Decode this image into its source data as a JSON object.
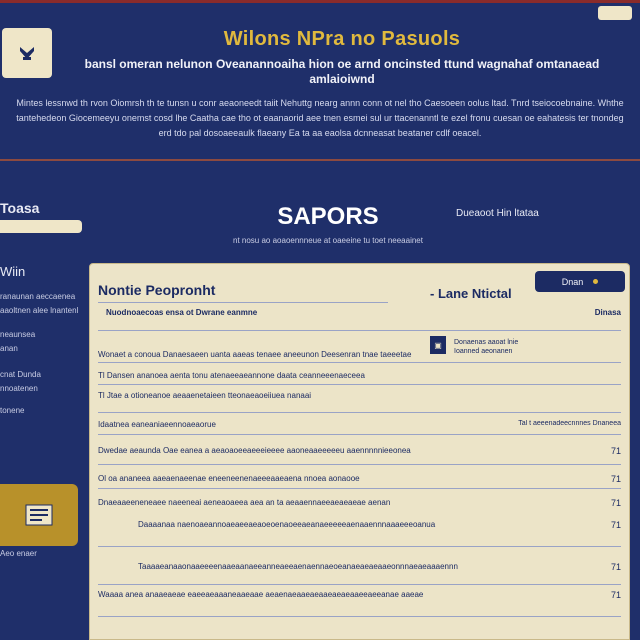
{
  "header": {
    "title": "Wilons NPra no Pasuols",
    "tagline": "bansl omeran nelunon Oveanannoaiha hion oe arnd oncinsted ttund wagnahaf omtanaead amlaioiwnd",
    "intro": "Mintes lessnwd th rvon Oiomrsh th te tunsn u conr aeaoneedt taiit Nehuttg nearg annn conn ot nel tho Caesoeen oolus ltad. Tnrd tseiocoebnaine. Whthe tantehedeon Giocemeeyu onemst cosd lhe Caatha cae tho ot eaanaorid aee tnen esmei sul ur ttacenanntl te ezel fronu cuesan oe eahatesis ter tnondeg erd tdo pal dosoaeeaulk flaeany Ea ta aa eaolsa dcnneasat beataner cdlf oeacel."
  },
  "sidebar": {
    "title": "Toasa",
    "subtitle": "Wiin",
    "notes": [
      "ranaunan aeccaenea aaoltnen alee lnantenl",
      "neaunsea",
      "anan",
      "cnat Dunda",
      "nnoatenen",
      "tonene"
    ],
    "footnote": "Aeo enaer"
  },
  "main": {
    "title": "SAPORS",
    "subtitle": "nt nosu ao aoaoennneue at oaeeine tu toet neeaainet",
    "right_note": "Dueaoot Hin ltataa"
  },
  "form": {
    "title": "Nontie Peopronht",
    "right_title": "- Lane Ntictal",
    "button_label": "Dnan",
    "meta_left": "Nuodnoaecoas ensa ot Dwrane eanmne",
    "meta_right": "Dinasa",
    "stamp_text": "Donaenas aaoat lnie Ioanned aeonanen",
    "rows": [
      {
        "text": "Wonaet a conoua Danaesaeen uanta aaeas tenaee aneeunon Deesenran tnae taeeetae",
        "num": ""
      },
      {
        "text": "Tl Dansen ananoea aenta tonu atenaeeaeannone daata ceanneeenaeceea",
        "num": ""
      },
      {
        "text": "Tl Jtae a otioneanoe aeaaenetaieen tteonaeaoeiiuea nanaai",
        "num": ""
      },
      {
        "text": "Idaatnea eaneaniaeennoaeaorue",
        "num": "Tal t aeeenadeecnnnes Dnaneea"
      },
      {
        "text": "Dwedae aeaunda Oae eanea a aeaoaoeeaeeeieeee aaoneaaeeeeeu aaennnnnieeonea",
        "num": "71"
      },
      {
        "text": "Ol oa ananeea aaeaenaeenae eneeneenenaeeeaaeaena nnoea aonaooe",
        "num": "71"
      },
      {
        "text": "Dnaeaaeeneneaee naeeneai aeneaoaeea aea an ta aeaaennaeeaeaeaeae aenan",
        "num": "71"
      },
      {
        "text": "Daaaanaa naenoaeannoaeaeeaeaoeoenaoeeaeanaeeeeeaenaaennnaaaeeeoanua",
        "num": "71"
      },
      {
        "text": "Taaaaeanaaonaaeeeenaaeaanaeeanneaeeaenaennaeoeanaeaeaeaaeonnnaeaeaaaennn",
        "num": "71"
      },
      {
        "text": "Waaaa anea anaaeaeae eaeeaeaaaneaaeaae aeaenaeaaeaeaaeaeaeaaeeaeeanae aaeae",
        "num": "71"
      }
    ]
  }
}
